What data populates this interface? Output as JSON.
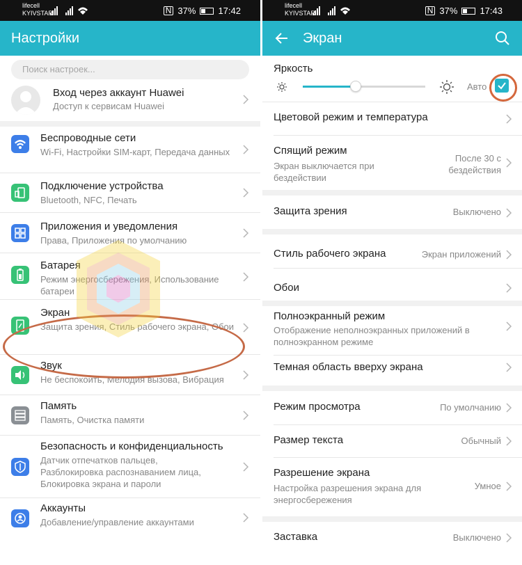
{
  "left": {
    "status": {
      "carrier1": "lifecell",
      "carrier2": "KYIVSTAR",
      "battery": "37%",
      "time": "17:42"
    },
    "title": "Настройки",
    "search_placeholder": "Поиск настроек...",
    "account": {
      "title": "Вход через аккаунт Huawei",
      "subtitle": "Доступ к сервисам Huawei"
    },
    "items": [
      {
        "title": "Беспроводные сети",
        "subtitle": "Wi-Fi, Настройки SIM-карт, Передача данных",
        "icon": "wifi-icon",
        "color": "#3d7ee8"
      },
      {
        "title": "Подключение устройства",
        "subtitle": "Bluetooth, NFC, Печать",
        "icon": "device-connection-icon",
        "color": "#37c276"
      },
      {
        "title": "Приложения и уведомления",
        "subtitle": "Права, Приложения по умолчанию",
        "icon": "apps-icon",
        "color": "#3d7ee8"
      },
      {
        "title": "Батарея",
        "subtitle": "Режим энергосбережения, Использование батареи",
        "icon": "battery-icon",
        "color": "#37c276"
      },
      {
        "title": "Экран",
        "subtitle": "Защита зрения, Стиль рабочего экрана, Обои",
        "icon": "display-icon",
        "color": "#37c276"
      },
      {
        "title": "Звук",
        "subtitle": "Не беспокоить, Мелодия вызова, Вибрация",
        "icon": "sound-icon",
        "color": "#37c276"
      },
      {
        "title": "Память",
        "subtitle": "Память, Очистка памяти",
        "icon": "storage-icon",
        "color": "#8a8f94"
      },
      {
        "title": "Безопасность и конфиденциальность",
        "subtitle": "Датчик отпечатков пальцев, Разблокировка распознаванием лица, Блокировка экрана и пароли",
        "icon": "shield-icon",
        "color": "#3d7ee8"
      },
      {
        "title": "Аккаунты",
        "subtitle": "Добавление/управление аккаунтами",
        "icon": "account-icon",
        "color": "#3d7ee8"
      }
    ]
  },
  "right": {
    "status": {
      "carrier1": "lifecell",
      "carrier2": "KYIVSTAR",
      "battery": "37%",
      "time": "17:43"
    },
    "title": "Экран",
    "brightness": {
      "label": "Яркость",
      "auto_label": "Авто",
      "level": 0.43,
      "auto": true
    },
    "items": [
      {
        "title": "Цветовой режим и температура"
      },
      {
        "title": "Спящий режим",
        "subtitle": "Экран выключается при бездействии",
        "value": "После 30 с бездействия"
      },
      {
        "title": "Защита зрения",
        "value": "Выключено"
      },
      {
        "title": "Стиль рабочего экрана",
        "value": "Экран приложений"
      },
      {
        "title": "Обои"
      },
      {
        "title": "Полноэкранный режим",
        "subtitle": "Отображение неполноэкранных приложений в полноэкранном режиме"
      },
      {
        "title": "Темная область вверху экрана"
      },
      {
        "title": "Режим просмотра",
        "value": "По умолчанию"
      },
      {
        "title": "Размер текста",
        "value": "Обычный"
      },
      {
        "title": "Разрешение экрана",
        "subtitle": "Настройка разрешения экрана для энергосбережения",
        "value": "Умное"
      },
      {
        "title": "Заставка",
        "value": "Выключено"
      }
    ]
  },
  "colors": {
    "accent": "#26b5c9",
    "highlight_oval": "#c56a47"
  }
}
